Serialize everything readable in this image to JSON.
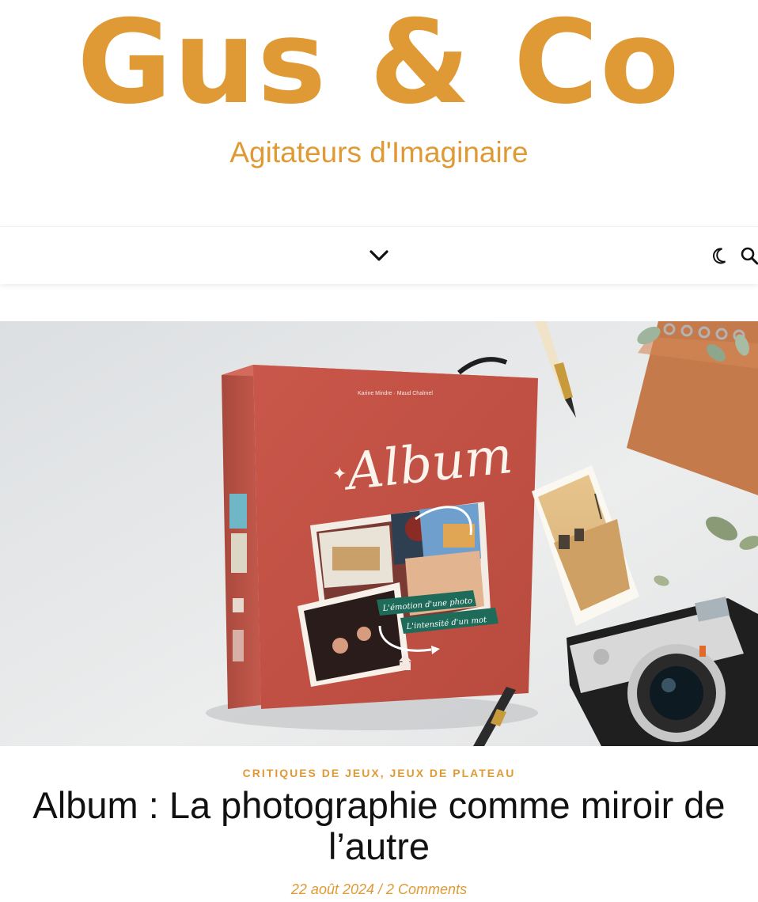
{
  "site": {
    "title": "Gus & Co",
    "tagline": "Agitateurs d'Imaginaire",
    "accent_color": "#e09a35"
  },
  "nav": {
    "menu_icon": "chevron-down-icon",
    "dark_mode_icon": "moon-icon",
    "search_icon": "search-icon"
  },
  "featured_image": {
    "box_title": "Album",
    "box_authors": [
      "Karine Mindre",
      "Maud Chalmel"
    ],
    "ribbon_lines": [
      "L'émotion d'une photo",
      "L'intensité d'un mot"
    ]
  },
  "post": {
    "categories": [
      "CRITIQUES DE JEUX",
      "JEUX DE PLATEAU"
    ],
    "category_separator": ", ",
    "title": "Album : La photographie comme miroir de l’autre",
    "date": "22 août 2024",
    "meta_separator": " / ",
    "comments": "2 Comments"
  }
}
